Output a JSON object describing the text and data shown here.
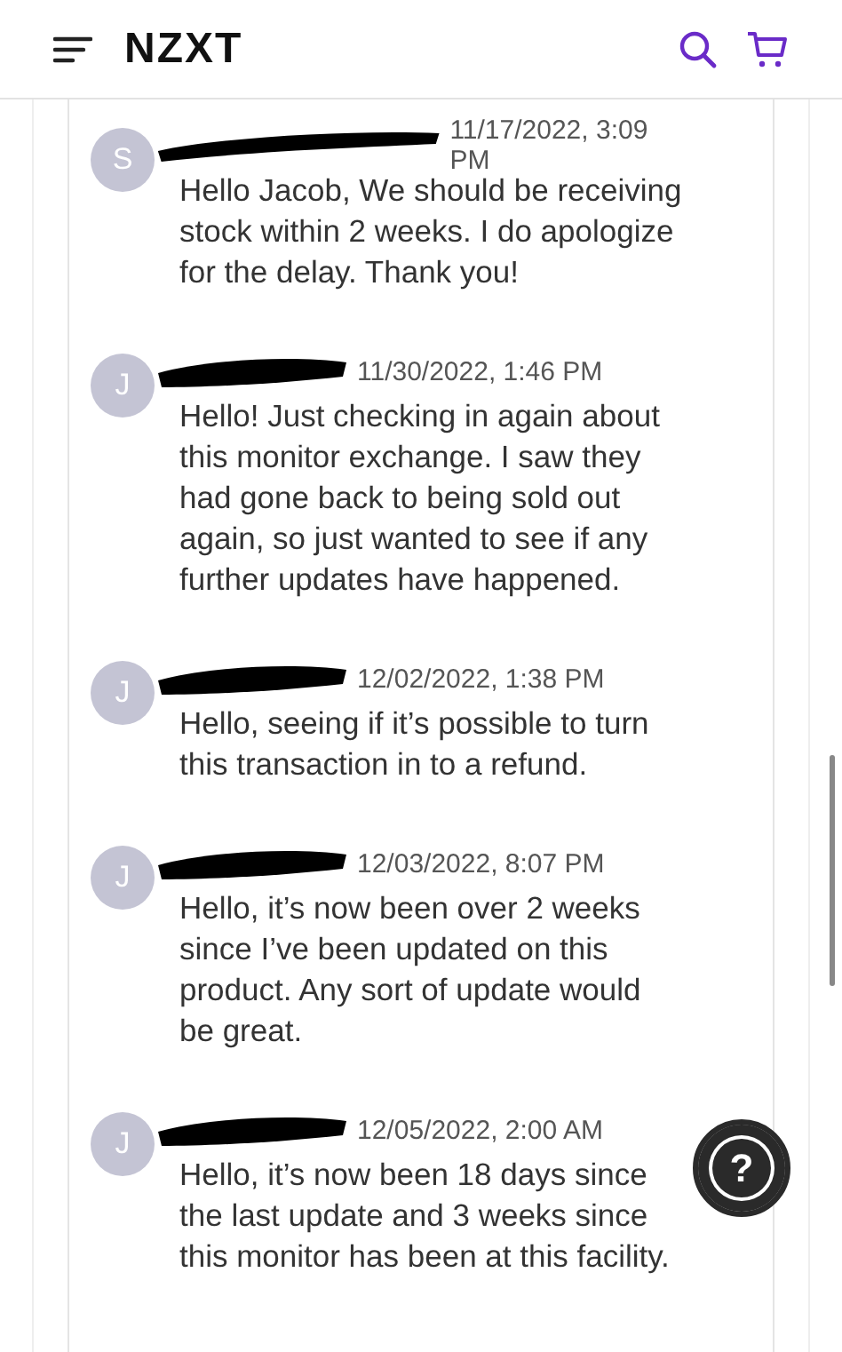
{
  "header": {
    "logo": "NZXT"
  },
  "messages": [
    {
      "avatar": "S",
      "time": "11/17/2022, 3:09 PM",
      "text": "Hello Jacob, We should be receiving stock within 2 weeks. I do apologize for the delay. Thank you!"
    },
    {
      "avatar": "J",
      "time": "11/30/2022, 1:46 PM",
      "text": "Hello! Just checking in again about this monitor exchange. I saw they had gone back to being sold out again, so just wanted to see if any further updates have happened."
    },
    {
      "avatar": "J",
      "time": "12/02/2022, 1:38 PM",
      "text": "Hello, seeing if it’s possible to turn this transaction in to a refund."
    },
    {
      "avatar": "J",
      "time": "12/03/2022, 8:07 PM",
      "text": "Hello, it’s now been over 2 weeks since I’ve been updated on this product. Any sort of update would be great."
    },
    {
      "avatar": "J",
      "time": "12/05/2022, 2:00 AM",
      "text": "Hello, it’s now been 18 days since the last update and 3 weeks since this monitor has been at this facility."
    }
  ],
  "help_button": "?"
}
